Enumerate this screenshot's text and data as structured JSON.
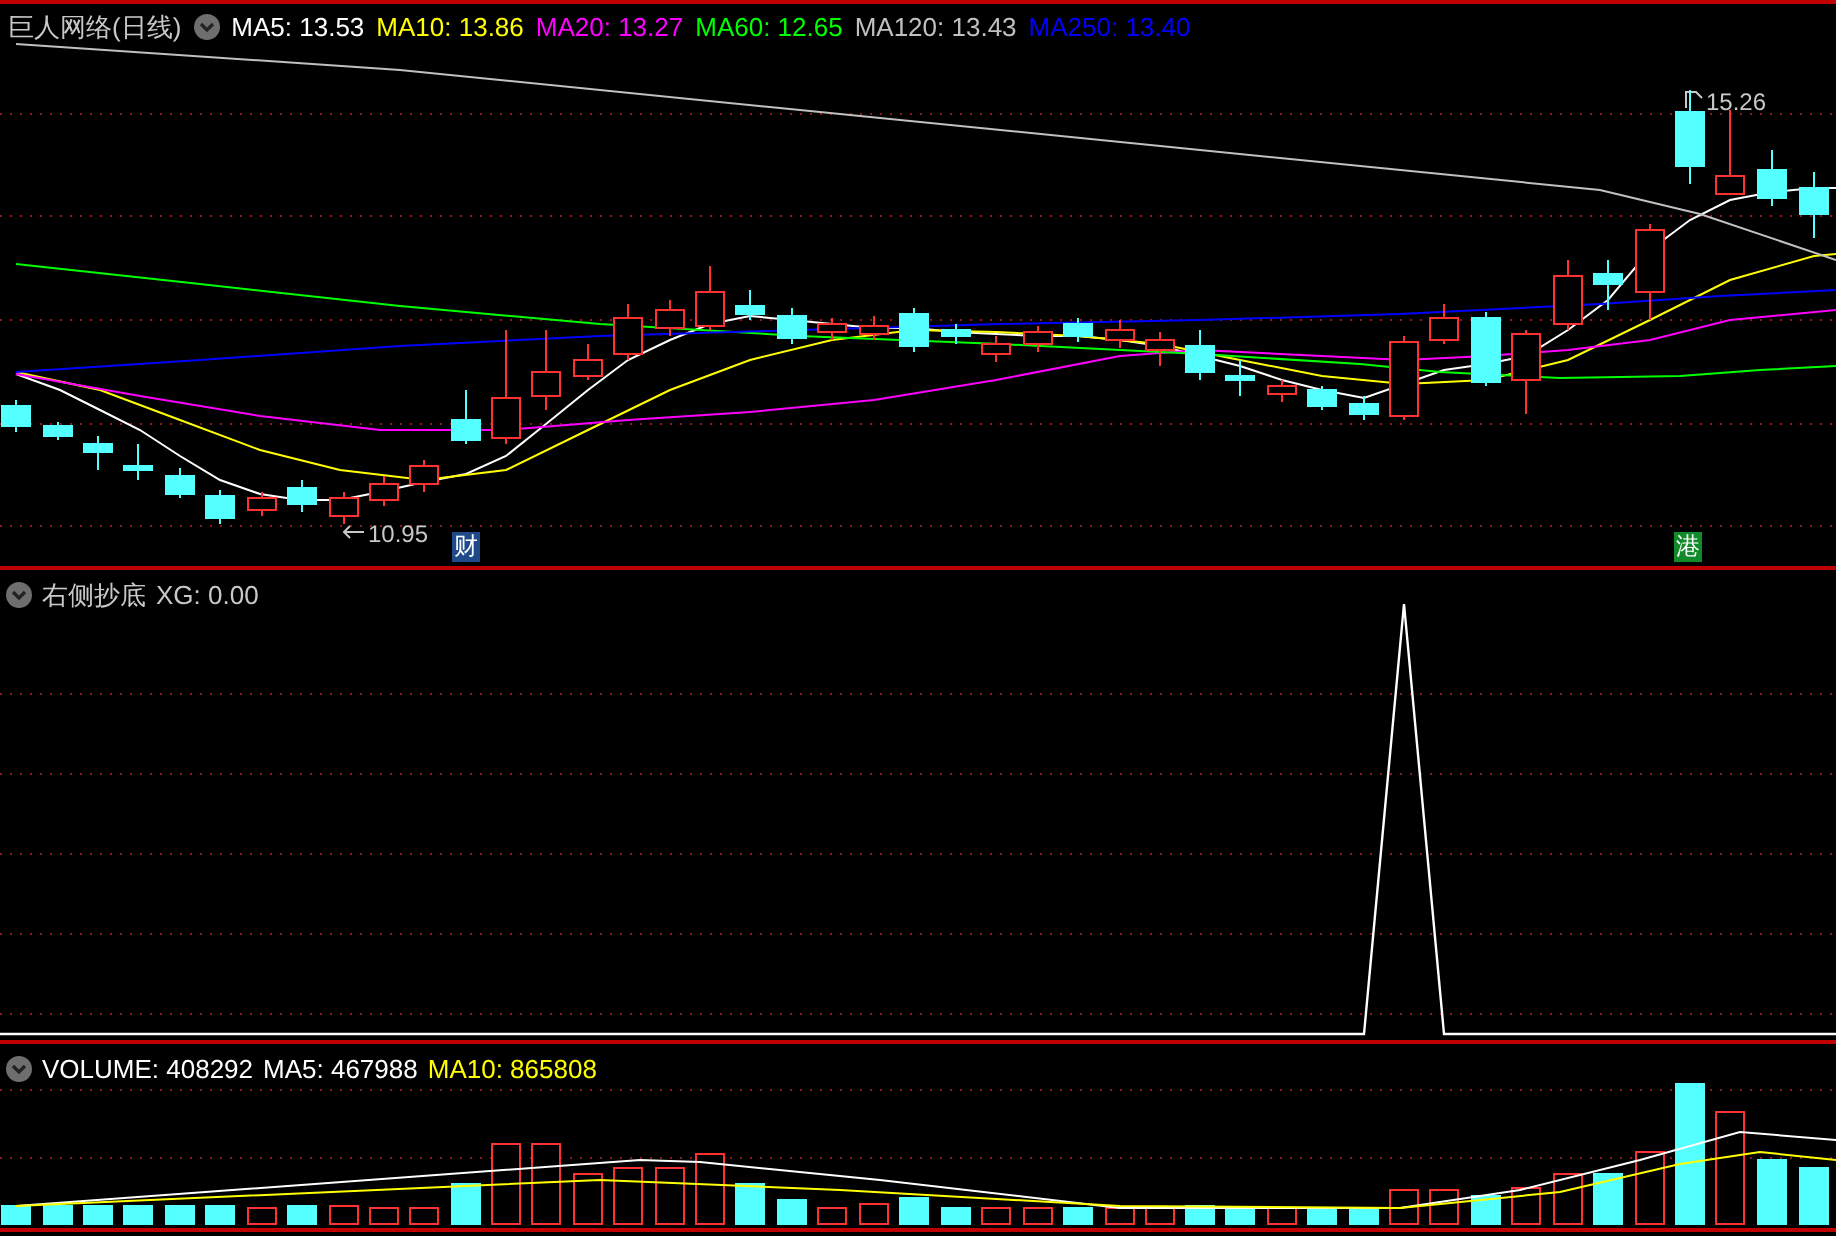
{
  "main_panel": {
    "title": "巨人网络(日线)",
    "indicators": [
      {
        "label": "MA5: 13.53",
        "color": "#ffffff"
      },
      {
        "label": "MA10: 13.86",
        "color": "#ffff00"
      },
      {
        "label": "MA20: 13.27",
        "color": "#ff00ff"
      },
      {
        "label": "MA60: 12.65",
        "color": "#00ff00"
      },
      {
        "label": "MA120: 13.43",
        "color": "#c0c0c0"
      },
      {
        "label": "MA250: 13.40",
        "color": "#0000ff"
      }
    ],
    "high_label": "15.26",
    "low_label": "10.95",
    "markers": [
      {
        "text": "财",
        "color": "#1e4a8a"
      },
      {
        "text": "港",
        "color": "#118a2a"
      }
    ]
  },
  "signal_panel": {
    "title": "右侧抄底",
    "reading": "XG: 0.00"
  },
  "volume_panel": {
    "readings": [
      {
        "label": "VOLUME: 408292",
        "color": "#ffffff"
      },
      {
        "label": "MA5: 467988",
        "color": "#ffffff"
      },
      {
        "label": "MA10: 865808",
        "color": "#ffff00"
      }
    ]
  }
}
